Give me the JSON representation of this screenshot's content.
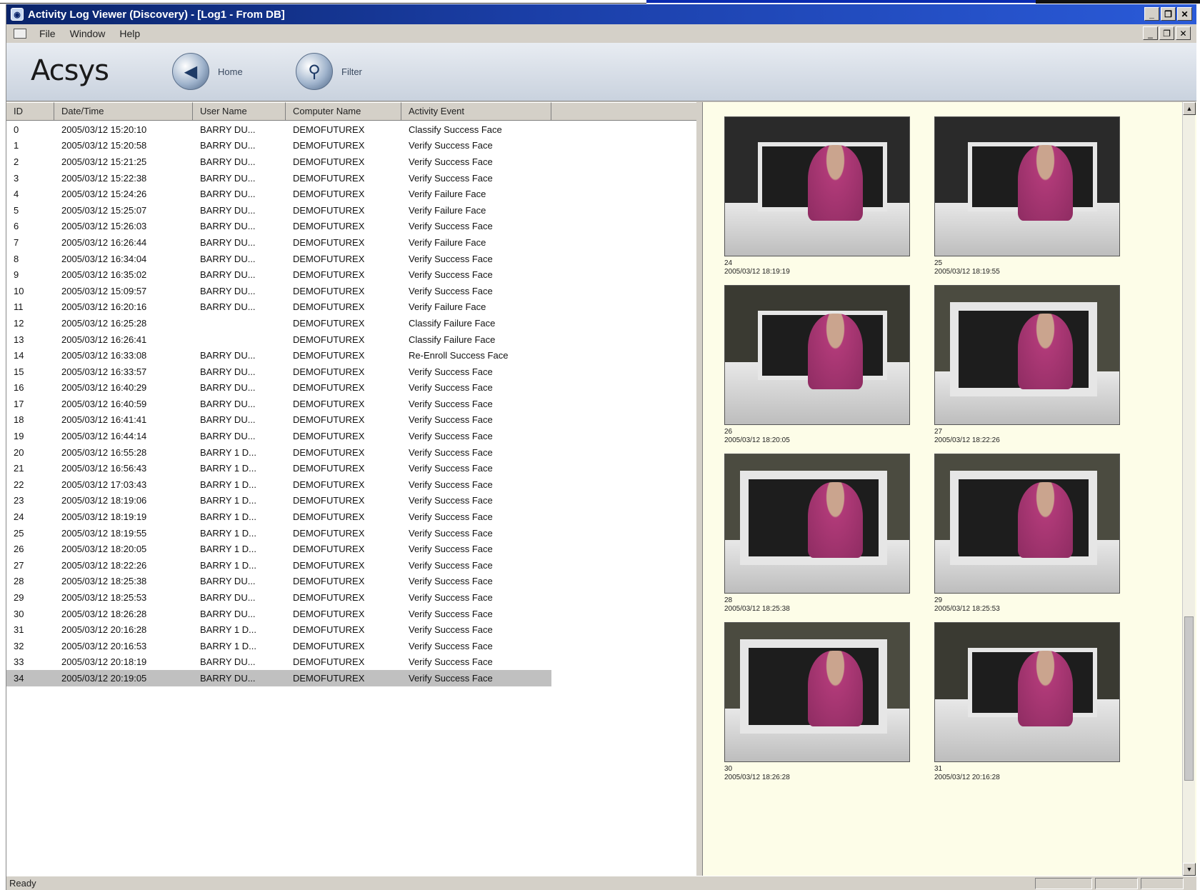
{
  "window": {
    "title": "Activity Log Viewer (Discovery) - [Log1 - From DB]",
    "buttons": [
      "_",
      "❐",
      "✕"
    ]
  },
  "menu": {
    "items": [
      "File",
      "Window",
      "Help"
    ],
    "mdi_buttons": [
      "_",
      "❐",
      "✕"
    ]
  },
  "toolbar": {
    "logo": "Acsys",
    "tools": [
      {
        "label": "Home",
        "icon": "home-icon"
      },
      {
        "label": "Filter",
        "icon": "filter-icon"
      }
    ]
  },
  "grid": {
    "columns": [
      "ID",
      "Date/Time",
      "User Name",
      "Computer Name",
      "Activity Event"
    ],
    "rows": [
      [
        "0",
        "2005/03/12 15:20:10",
        "BARRY DU...",
        "DEMOFUTUREX",
        "Classify Success Face"
      ],
      [
        "1",
        "2005/03/12 15:20:58",
        "BARRY DU...",
        "DEMOFUTUREX",
        "Verify Success Face"
      ],
      [
        "2",
        "2005/03/12 15:21:25",
        "BARRY DU...",
        "DEMOFUTUREX",
        "Verify Success Face"
      ],
      [
        "3",
        "2005/03/12 15:22:38",
        "BARRY DU...",
        "DEMOFUTUREX",
        "Verify Success Face"
      ],
      [
        "4",
        "2005/03/12 15:24:26",
        "BARRY DU...",
        "DEMOFUTUREX",
        "Verify Failure Face"
      ],
      [
        "5",
        "2005/03/12 15:25:07",
        "BARRY DU...",
        "DEMOFUTUREX",
        "Verify Failure Face"
      ],
      [
        "6",
        "2005/03/12 15:26:03",
        "BARRY DU...",
        "DEMOFUTUREX",
        "Verify Success Face"
      ],
      [
        "7",
        "2005/03/12 16:26:44",
        "BARRY DU...",
        "DEMOFUTUREX",
        "Verify Failure Face"
      ],
      [
        "8",
        "2005/03/12 16:34:04",
        "BARRY DU...",
        "DEMOFUTUREX",
        "Verify Success Face"
      ],
      [
        "9",
        "2005/03/12 16:35:02",
        "BARRY DU...",
        "DEMOFUTUREX",
        "Verify Success Face"
      ],
      [
        "10",
        "2005/03/12 15:09:57",
        "BARRY DU...",
        "DEMOFUTUREX",
        "Verify Success Face"
      ],
      [
        "11",
        "2005/03/12 16:20:16",
        "BARRY DU...",
        "DEMOFUTUREX",
        "Verify Failure Face"
      ],
      [
        "12",
        "2005/03/12 16:25:28",
        "",
        "DEMOFUTUREX",
        "Classify Failure Face"
      ],
      [
        "13",
        "2005/03/12 16:26:41",
        "",
        "DEMOFUTUREX",
        "Classify Failure Face"
      ],
      [
        "14",
        "2005/03/12 16:33:08",
        "BARRY DU...",
        "DEMOFUTUREX",
        "Re-Enroll Success Face"
      ],
      [
        "15",
        "2005/03/12 16:33:57",
        "BARRY DU...",
        "DEMOFUTUREX",
        "Verify Success Face"
      ],
      [
        "16",
        "2005/03/12 16:40:29",
        "BARRY DU...",
        "DEMOFUTUREX",
        "Verify Success Face"
      ],
      [
        "17",
        "2005/03/12 16:40:59",
        "BARRY DU...",
        "DEMOFUTUREX",
        "Verify Success Face"
      ],
      [
        "18",
        "2005/03/12 16:41:41",
        "BARRY DU...",
        "DEMOFUTUREX",
        "Verify Success Face"
      ],
      [
        "19",
        "2005/03/12 16:44:14",
        "BARRY DU...",
        "DEMOFUTUREX",
        "Verify Success Face"
      ],
      [
        "20",
        "2005/03/12 16:55:28",
        "BARRY 1 D...",
        "DEMOFUTUREX",
        "Verify Success Face"
      ],
      [
        "21",
        "2005/03/12 16:56:43",
        "BARRY 1 D...",
        "DEMOFUTUREX",
        "Verify Success Face"
      ],
      [
        "22",
        "2005/03/12 17:03:43",
        "BARRY 1 D...",
        "DEMOFUTUREX",
        "Verify Success Face"
      ],
      [
        "23",
        "2005/03/12 18:19:06",
        "BARRY 1 D...",
        "DEMOFUTUREX",
        "Verify Success Face"
      ],
      [
        "24",
        "2005/03/12 18:19:19",
        "BARRY 1 D...",
        "DEMOFUTUREX",
        "Verify Success Face"
      ],
      [
        "25",
        "2005/03/12 18:19:55",
        "BARRY 1 D...",
        "DEMOFUTUREX",
        "Verify Success Face"
      ],
      [
        "26",
        "2005/03/12 18:20:05",
        "BARRY 1 D...",
        "DEMOFUTUREX",
        "Verify Success Face"
      ],
      [
        "27",
        "2005/03/12 18:22:26",
        "BARRY 1 D...",
        "DEMOFUTUREX",
        "Verify Success Face"
      ],
      [
        "28",
        "2005/03/12 18:25:38",
        "BARRY DU...",
        "DEMOFUTUREX",
        "Verify Success Face"
      ],
      [
        "29",
        "2005/03/12 18:25:53",
        "BARRY DU...",
        "DEMOFUTUREX",
        "Verify Success Face"
      ],
      [
        "30",
        "2005/03/12 18:26:28",
        "BARRY DU...",
        "DEMOFUTUREX",
        "Verify Success Face"
      ],
      [
        "31",
        "2005/03/12 20:16:28",
        "BARRY 1 D...",
        "DEMOFUTUREX",
        "Verify Success Face"
      ],
      [
        "32",
        "2005/03/12 20:16:53",
        "BARRY 1 D...",
        "DEMOFUTUREX",
        "Verify Success Face"
      ],
      [
        "33",
        "2005/03/12 20:18:19",
        "BARRY DU...",
        "DEMOFUTUREX",
        "Verify Success Face"
      ],
      [
        "34",
        "2005/03/12 20:19:05",
        "BARRY DU...",
        "DEMOFUTUREX",
        "Verify Success Face"
      ]
    ],
    "selected_row": "34"
  },
  "thumbnails": [
    {
      "id": "24",
      "timestamp": "2005/03/12 18:19:19",
      "style": "style1"
    },
    {
      "id": "25",
      "timestamp": "2005/03/12 18:19:55",
      "style": "style1"
    },
    {
      "id": "26",
      "timestamp": "2005/03/12 18:20:05",
      "style": "style2"
    },
    {
      "id": "27",
      "timestamp": "2005/03/12 18:22:26",
      "style": "style3"
    },
    {
      "id": "28",
      "timestamp": "2005/03/12 18:25:38",
      "style": "style3"
    },
    {
      "id": "29",
      "timestamp": "2005/03/12 18:25:53",
      "style": "style3"
    },
    {
      "id": "30",
      "timestamp": "2005/03/12 18:26:28",
      "style": "style3"
    },
    {
      "id": "31",
      "timestamp": "2005/03/12 20:16:28",
      "style": "style2"
    }
  ],
  "status": {
    "text": "Ready"
  },
  "colors": {
    "titlebar": "#0a246a",
    "thumbnail_pane": "#fdfde8",
    "selected_row": "#c0c0c0"
  }
}
